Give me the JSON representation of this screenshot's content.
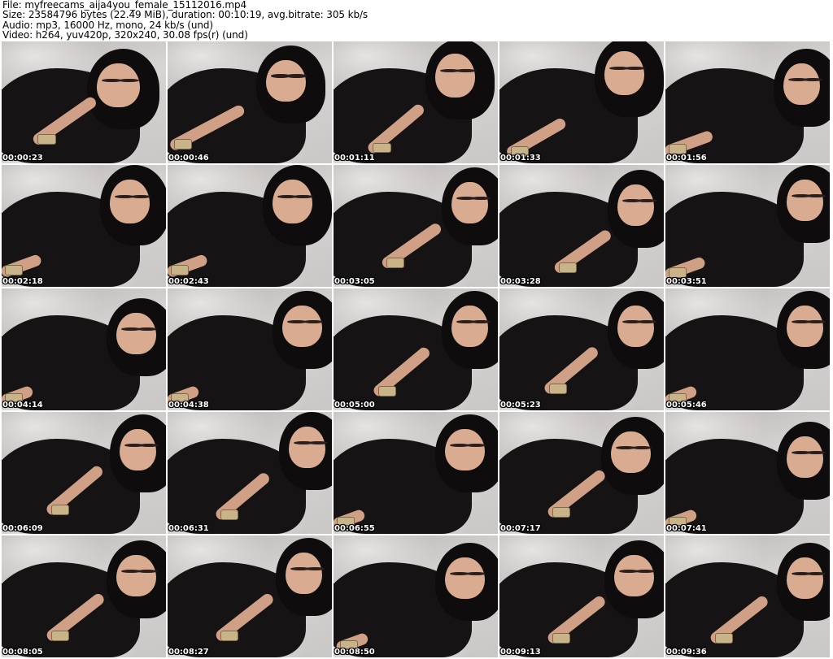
{
  "header": {
    "file": "File: myfreecams_aija4you_female_15112016.mp4",
    "size": "Size: 23584796 bytes (22.49 MiB), duration: 00:10:19, avg.bitrate: 305 kb/s",
    "audio": "Audio: mp3, 16000 Hz, mono, 24 kb/s (und)",
    "video": "Video: h264, yuv420p, 320x240, 30.08 fps(r) (und)"
  },
  "thumbnails": [
    {
      "time": "00:00:23"
    },
    {
      "time": "00:00:46"
    },
    {
      "time": "00:01:11"
    },
    {
      "time": "00:01:33"
    },
    {
      "time": "00:01:56"
    },
    {
      "time": "00:02:18"
    },
    {
      "time": "00:02:43"
    },
    {
      "time": "00:03:05"
    },
    {
      "time": "00:03:28"
    },
    {
      "time": "00:03:51"
    },
    {
      "time": "00:04:14"
    },
    {
      "time": "00:04:38"
    },
    {
      "time": "00:05:00"
    },
    {
      "time": "00:05:23"
    },
    {
      "time": "00:05:46"
    },
    {
      "time": "00:06:09"
    },
    {
      "time": "00:06:31"
    },
    {
      "time": "00:06:55"
    },
    {
      "time": "00:07:17"
    },
    {
      "time": "00:07:41"
    },
    {
      "time": "00:08:05"
    },
    {
      "time": "00:08:27"
    },
    {
      "time": "00:08:50"
    },
    {
      "time": "00:09:13"
    },
    {
      "time": "00:09:36"
    }
  ]
}
